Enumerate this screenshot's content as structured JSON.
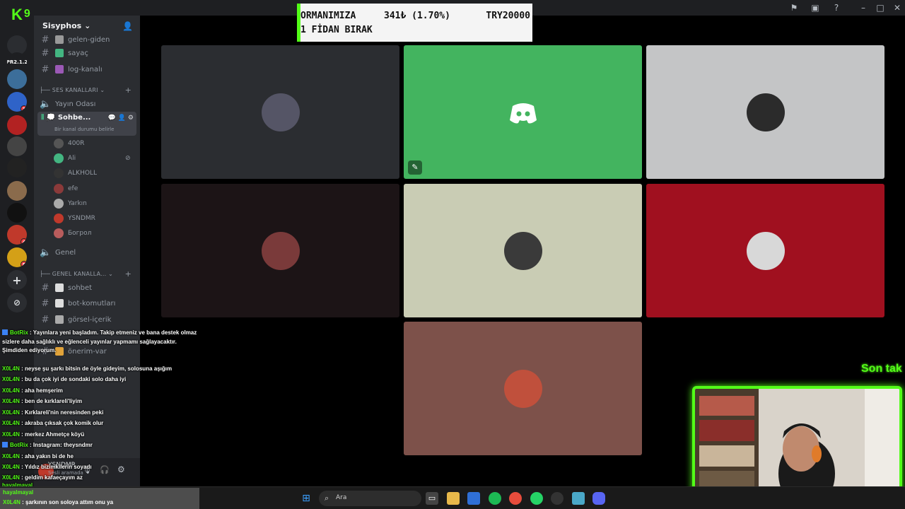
{
  "overlay": {
    "kick_logo": "K",
    "kick_number": "9",
    "banner": {
      "line1": "ORMANIMIZA",
      "amount": "341₺ (1.70%)",
      "goal": "TRY20000",
      "line2": "1 FİDAN BIRAK"
    },
    "son_tak": "Son tak"
  },
  "servers": [
    {
      "label": "",
      "color": "#2b2d31",
      "badge": ""
    },
    {
      "label": "PR2.1.2",
      "color": "#1e1f22",
      "badge": ""
    },
    {
      "label": "",
      "color": "#3c6e9a",
      "badge": ""
    },
    {
      "label": "",
      "color": "#2f63c8",
      "badge": "1"
    },
    {
      "label": "",
      "color": "#b22222",
      "badge": ""
    },
    {
      "label": "",
      "color": "#444",
      "badge": ""
    },
    {
      "label": "",
      "color": "#222",
      "badge": ""
    },
    {
      "label": "",
      "color": "#8a6b4c",
      "badge": ""
    },
    {
      "label": "",
      "color": "#111",
      "badge": ""
    },
    {
      "label": "",
      "color": "#c0392b",
      "badge": "4"
    },
    {
      "label": "",
      "color": "#d4a017",
      "badge": "8"
    }
  ],
  "sidebar": {
    "server_name": "Sisyphos",
    "channels_top": [
      {
        "name": "gelen-giden",
        "emoji_color": "#999"
      },
      {
        "name": "sayaç",
        "emoji_color": "#43b581"
      },
      {
        "name": "log-kanalı",
        "emoji_color": "#9b59b6"
      }
    ],
    "cat_voice": "SES KANALLARI",
    "voice_channel_1": "Yayın Odası",
    "voice_active": "Sohbe...",
    "voice_status": "Bir kanal durumu belirle",
    "members": [
      {
        "name": "400R",
        "color": "#555"
      },
      {
        "name": "Ali",
        "color": "#43b581"
      },
      {
        "name": "ALKHOLL",
        "color": "#333"
      },
      {
        "name": "efe",
        "color": "#8b3a3a"
      },
      {
        "name": "Yarkın",
        "color": "#aaa"
      },
      {
        "name": "YSNDMR",
        "color": "#c0392b"
      },
      {
        "name": "Богрол",
        "color": "#b85c5c"
      }
    ],
    "voice_channel_2": "Genel",
    "cat_general": "GENEL KANALLA...",
    "channels_general": [
      {
        "name": "sohbet",
        "emoji_color": "#ddd"
      },
      {
        "name": "bot-komutları",
        "emoji_color": "#ddd"
      },
      {
        "name": "görsel-içerik",
        "emoji_color": "#aaa"
      },
      {
        "name": "önerim-var",
        "emoji_color": "#e1a33a"
      }
    ],
    "user_name": "YSNDMR",
    "user_status": "Sesli aramada"
  },
  "tiles": [
    {
      "bg": "#2b2d31",
      "avatar": "#556"
    },
    {
      "bg": "#43b45f",
      "avatar": "discord"
    },
    {
      "bg": "#c4c5c6",
      "avatar": "#2b2b2b"
    },
    {
      "bg": "#1c1416",
      "avatar": "#7a3a3a"
    },
    {
      "bg": "#c9ccb4",
      "avatar": "#3a3a3a"
    },
    {
      "bg": "#a0101f",
      "avatar": "#d8d8d8"
    },
    {
      "bg": "#7d514a",
      "avatar": "#c0503c"
    }
  ],
  "chat": [
    {
      "user": "BotRix",
      "bot": true,
      "text": "Yayınlara yeni başladım. Takip etmeniz ve bana destek olmaz sizlere daha sağlıklı ve eğlenceli yayınlar yapmamı sağlayacaktır. Şimdiden ediyorum."
    },
    {
      "user": "X0L4N",
      "bot": false,
      "text": "neyse şu şarkı bitsin de öyle gideyim, solosuna aşığım"
    },
    {
      "user": "X0L4N",
      "bot": false,
      "text": "bu da çok iyi de sondaki solo daha iyi"
    },
    {
      "user": "X0L4N",
      "bot": false,
      "text": "aha hemşerim"
    },
    {
      "user": "X0L4N",
      "bot": false,
      "text": "ben de kırklareli'liyim"
    },
    {
      "user": "X0L4N",
      "bot": false,
      "text": "Kırklareli'nin neresinden peki"
    },
    {
      "user": "X0L4N",
      "bot": false,
      "text": "akraba çıksak çok komik olur"
    },
    {
      "user": "X0L4N",
      "bot": false,
      "text": "merkez Ahmetçe köyü"
    },
    {
      "user": "BotRix",
      "bot": true,
      "text": "Instagram: theysndmr"
    },
    {
      "user": "X0L4N",
      "bot": false,
      "text": "aha yakın bi de he"
    },
    {
      "user": "X0L4N",
      "bot": false,
      "text": "Yıldız bizimkilerin soyadı"
    },
    {
      "user": "X0L4N",
      "bot": false,
      "text": "geldim kafaeçayım az"
    }
  ],
  "chat_tail": [
    {
      "user": "hayalmayal",
      "text": ""
    },
    {
      "user": "X0L4N",
      "text": "şarkının son soloya attım onu ya"
    }
  ],
  "chat_extra_user": "hayalmayal",
  "taskbar": {
    "search_placeholder": "Ara"
  }
}
